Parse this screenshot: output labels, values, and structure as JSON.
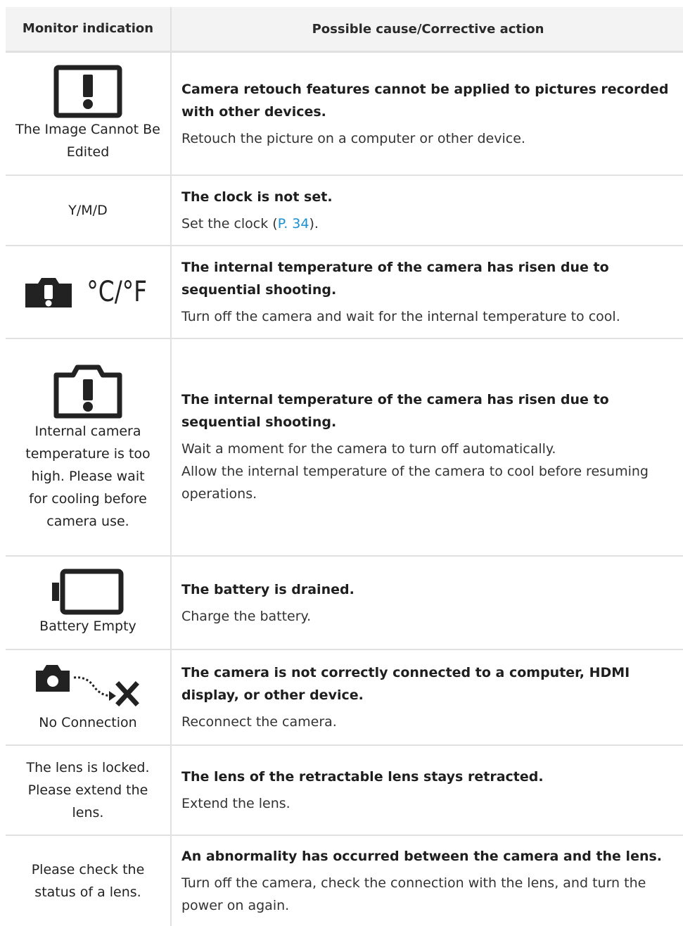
{
  "header": {
    "monitor_indication": "Monitor indication",
    "cause_action": "Possible cause/Corrective action"
  },
  "rows": [
    {
      "icon": "warning-box-icon",
      "indication": "The Image Cannot Be Edited",
      "cause": "Camera retouch features cannot be applied to pictures recorded with other devices.",
      "action": "Retouch the picture on a computer or other device."
    },
    {
      "indication": "Y/M/D",
      "cause": "The clock is not set.",
      "action_pre": "Set the clock (",
      "action_link": "P. 34",
      "action_post": ")."
    },
    {
      "icon": "camera-temperature-warning-icon",
      "icon_text": "°C/°F",
      "cause": "The internal temperature of the camera has risen due to sequential shooting.",
      "action": "Turn off the camera and wait for the internal temperature to cool."
    },
    {
      "icon": "camera-warning-outline-icon",
      "indication": "Internal camera temperature is too high. Please wait for cooling before camera use.",
      "cause": "The internal temperature of the camera has risen due to sequential shooting.",
      "action_line1": "Wait a moment for the camera to turn off automatically.",
      "action_line2": "Allow the internal temperature of the camera to cool before resuming operations."
    },
    {
      "icon": "battery-empty-icon",
      "indication": "Battery Empty",
      "cause": "The battery is drained.",
      "action": "Charge the battery."
    },
    {
      "icon": "no-connection-icon",
      "indication": "No Connection",
      "cause": "The camera is not correctly connected to a computer, HDMI display, or other device.",
      "action": "Reconnect the camera."
    },
    {
      "indication": "The lens is locked. Please extend the lens.",
      "cause": "The lens of the retractable lens stays retracted.",
      "action": "Extend the lens."
    },
    {
      "indication": "Please check the status of a lens.",
      "cause": "An abnormality has occurred between the camera and the lens.",
      "action": "Turn off the camera, check the connection with the lens, and turn the power on again."
    }
  ],
  "colors": {
    "border": "#e1e1e1",
    "header_bg": "#f3f3f3",
    "link": "#1a8fd1",
    "icon": "#222222"
  }
}
